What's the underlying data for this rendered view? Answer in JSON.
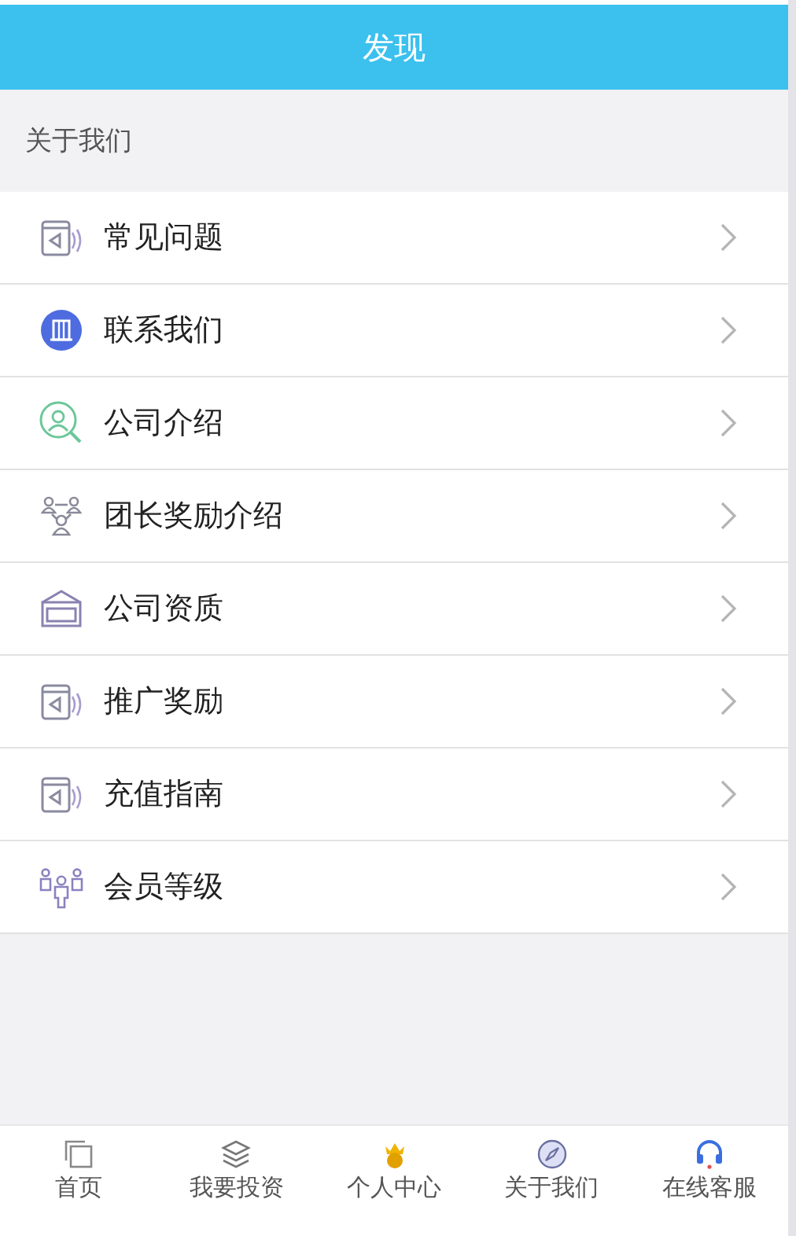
{
  "header": {
    "title": "发现"
  },
  "section": {
    "label": "关于我们"
  },
  "items": [
    {
      "label": "常见问题",
      "kind": "speaker"
    },
    {
      "label": "联系我们",
      "kind": "building"
    },
    {
      "label": "公司介绍",
      "kind": "person-search"
    },
    {
      "label": "团长奖励介绍",
      "kind": "team"
    },
    {
      "label": "公司资质",
      "kind": "box"
    },
    {
      "label": "推广奖励",
      "kind": "speaker"
    },
    {
      "label": "充值指南",
      "kind": "speaker"
    },
    {
      "label": "会员等级",
      "kind": "members"
    }
  ],
  "tabbar": [
    {
      "label": "首页",
      "kind": "pages"
    },
    {
      "label": "我要投资",
      "kind": "layers"
    },
    {
      "label": "个人中心",
      "kind": "vip"
    },
    {
      "label": "关于我们",
      "kind": "compass"
    },
    {
      "label": "在线客服",
      "kind": "headset"
    }
  ]
}
